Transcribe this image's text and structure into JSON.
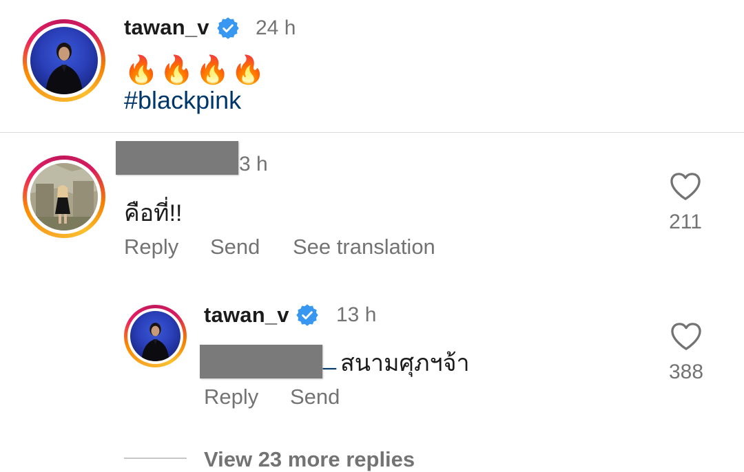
{
  "caption": {
    "username": "tawan_v",
    "time": "24 h",
    "emoji": "🔥🔥🔥🔥",
    "hashtag": "#blackpink"
  },
  "comment": {
    "time_partial": "3 h",
    "text": "คือที่!!",
    "likes": "211",
    "actions": {
      "reply": "Reply",
      "send": "Send",
      "see_translation": "See translation"
    }
  },
  "reply": {
    "username": "tawan_v",
    "time": "13 h",
    "mention_tail": "_",
    "text": "สนามศุภฯจ้า",
    "likes": "388",
    "actions": {
      "reply": "Reply",
      "send": "Send"
    }
  },
  "view_more": "View 23 more replies",
  "colors": {
    "verified": "#3897f0",
    "mention": "#00376b",
    "muted": "#737373"
  },
  "icons": [
    "verified-badge-icon",
    "heart-icon"
  ]
}
